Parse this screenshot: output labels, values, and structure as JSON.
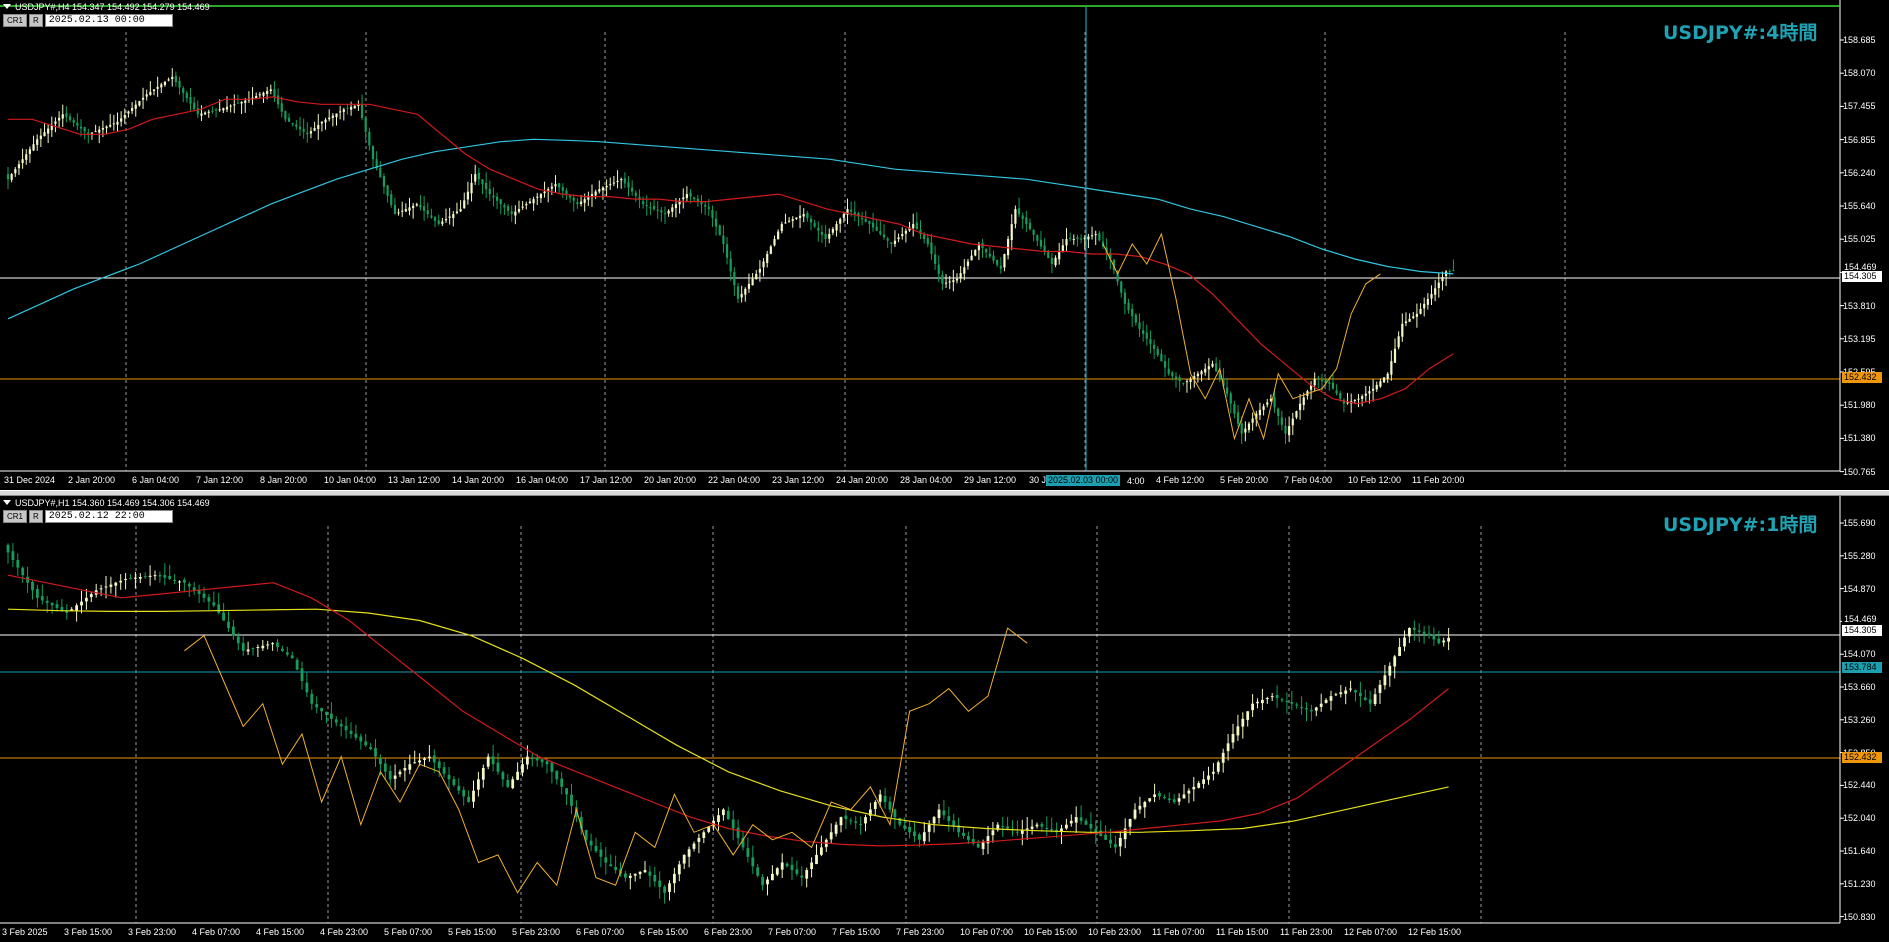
{
  "colors": {
    "background": "#000000",
    "bull": "#f4f7c6",
    "bear": "#149e5c",
    "ma_fast": "#d11a1a",
    "ma_slow_h4": "#31c6e0",
    "ma_slow_h1": "#e5e01a",
    "zigzag": "#f0b030",
    "support": "#f0960a",
    "current_price": "#ffffff",
    "crosshair": "#1aa0b0",
    "title": "#1fa3b4"
  },
  "top_panel": {
    "header": "USDJPY#,H4  154.347 154.492 154.279 154.469",
    "button_cr1": "CR1",
    "button_r": "R",
    "time_value": "2025.02.13 00:00",
    "title": "USDJPY#:4時間",
    "price_ticks": [
      "158.685",
      "158.070",
      "157.455",
      "156.855",
      "156.240",
      "155.640",
      "155.025",
      "154.410",
      "153.810",
      "153.195",
      "152.595",
      "151.980",
      "151.380",
      "150.765"
    ],
    "current_price_label": "154.469",
    "line_price_label": "154.305",
    "support_label": "152.432",
    "time_ticks": [
      "31 Dec 2024",
      "2 Jan 20:00",
      "6 Jan 04:00",
      "7 Jan 12:00",
      "8 Jan 20:00",
      "10 Jan 04:00",
      "13 Jan 12:00",
      "14 Jan 20:00",
      "16 Jan 04:00",
      "17 Jan 12:00",
      "20 Jan 20:00",
      "22 Jan 04:00",
      "23 Jan 12:00",
      "24 Jan 20:00",
      "28 Jan 04:00",
      "29 Jan 12:00",
      "30 J",
      "4 Feb 12:00",
      "5 Feb 20:00",
      "7 Feb 04:00",
      "10 Feb 12:00",
      "11 Feb 20:00"
    ],
    "crosshair_time": "2025.02.03 00:00",
    "crosshair_suffix": "4:00",
    "price_range": [
      150.45,
      159.25
    ],
    "series": {
      "start": 154.6,
      "path": [
        [
          0,
          156.3
        ],
        [
          8,
          157.1
        ],
        [
          15,
          157.6
        ],
        [
          22,
          157.2
        ],
        [
          30,
          157.45
        ],
        [
          38,
          158.0
        ],
        [
          45,
          158.35
        ],
        [
          52,
          157.6
        ],
        [
          58,
          157.7
        ],
        [
          66,
          157.9
        ],
        [
          72,
          158.1
        ],
        [
          76,
          157.5
        ],
        [
          82,
          157.2
        ],
        [
          86,
          157.45
        ],
        [
          92,
          157.7
        ],
        [
          96,
          157.8
        ],
        [
          100,
          156.7
        ],
        [
          106,
          155.6
        ],
        [
          112,
          155.8
        ],
        [
          118,
          155.4
        ],
        [
          124,
          155.7
        ],
        [
          128,
          156.4
        ],
        [
          132,
          156.0
        ],
        [
          138,
          155.6
        ],
        [
          144,
          155.9
        ],
        [
          150,
          156.2
        ],
        [
          156,
          155.8
        ],
        [
          162,
          156.1
        ],
        [
          168,
          156.3
        ],
        [
          174,
          155.8
        ],
        [
          180,
          155.6
        ],
        [
          186,
          156.0
        ],
        [
          192,
          155.7
        ],
        [
          196,
          155.0
        ],
        [
          200,
          153.9
        ],
        [
          206,
          154.5
        ],
        [
          212,
          155.4
        ],
        [
          218,
          155.6
        ],
        [
          224,
          155.1
        ],
        [
          230,
          155.7
        ],
        [
          236,
          155.4
        ],
        [
          242,
          155.0
        ],
        [
          248,
          155.4
        ],
        [
          252,
          155.0
        ],
        [
          256,
          154.2
        ],
        [
          260,
          154.3
        ],
        [
          266,
          155.0
        ],
        [
          272,
          154.5
        ],
        [
          276,
          155.7
        ],
        [
          280,
          155.3
        ],
        [
          286,
          154.6
        ],
        [
          290,
          155.1
        ],
        [
          294,
          155.1
        ],
        [
          298,
          155.2
        ],
        [
          302,
          154.7
        ],
        [
          306,
          153.8
        ],
        [
          310,
          153.3
        ],
        [
          314,
          152.9
        ],
        [
          318,
          152.4
        ],
        [
          322,
          152.2
        ],
        [
          326,
          152.4
        ],
        [
          330,
          152.6
        ],
        [
          334,
          152.0
        ],
        [
          338,
          151.2
        ],
        [
          342,
          151.6
        ],
        [
          346,
          151.9
        ],
        [
          350,
          151.2
        ],
        [
          354,
          151.8
        ],
        [
          358,
          152.3
        ],
        [
          362,
          152.2
        ],
        [
          366,
          151.8
        ],
        [
          370,
          151.9
        ],
        [
          374,
          152.1
        ],
        [
          378,
          152.4
        ],
        [
          382,
          153.4
        ],
        [
          386,
          153.6
        ],
        [
          390,
          154.0
        ],
        [
          394,
          154.45
        ],
        [
          396,
          154.47
        ]
      ],
      "ma_fast_values": [
        157.5,
        157.5,
        157.35,
        157.2,
        157.2,
        157.3,
        157.5,
        157.6,
        157.7,
        157.9,
        157.9,
        157.95,
        157.85,
        157.8,
        157.8,
        157.8,
        157.7,
        157.6,
        157.2,
        156.8,
        156.5,
        156.3,
        156.1,
        156.0,
        155.95,
        155.95,
        155.9,
        155.9,
        155.85,
        155.85,
        155.9,
        155.95,
        156.0,
        155.85,
        155.7,
        155.6,
        155.5,
        155.4,
        155.2,
        155.1,
        155.0,
        154.95,
        154.9,
        154.85,
        154.85,
        154.8,
        154.8,
        154.75,
        154.6,
        154.4,
        154.0,
        153.5,
        153.0,
        152.6,
        152.2,
        151.9,
        151.8,
        151.9,
        152.1,
        152.5,
        152.8
      ],
      "ma_slow_values": [
        153.5,
        153.8,
        154.1,
        154.35,
        154.6,
        154.9,
        155.2,
        155.5,
        155.8,
        156.05,
        156.3,
        156.5,
        156.7,
        156.85,
        156.95,
        157.05,
        157.1,
        157.08,
        157.05,
        157.0,
        156.95,
        156.9,
        156.85,
        156.8,
        156.75,
        156.7,
        156.6,
        156.5,
        156.45,
        156.4,
        156.35,
        156.3,
        156.2,
        156.1,
        156.0,
        155.9,
        155.7,
        155.55,
        155.35,
        155.15,
        154.9,
        154.7,
        154.55,
        154.45,
        154.4
      ],
      "zigzag": [
        [
          300,
          155.0
        ],
        [
          304,
          154.4
        ],
        [
          308,
          155.0
        ],
        [
          312,
          154.6
        ],
        [
          316,
          155.2
        ],
        [
          320,
          153.9
        ],
        [
          324,
          152.4
        ],
        [
          328,
          151.9
        ],
        [
          332,
          152.5
        ],
        [
          336,
          151.1
        ],
        [
          340,
          151.9
        ],
        [
          344,
          151.1
        ],
        [
          348,
          152.4
        ],
        [
          352,
          151.9
        ],
        [
          356,
          152.0
        ],
        [
          360,
          152.1
        ],
        [
          364,
          152.5
        ],
        [
          368,
          153.6
        ],
        [
          372,
          154.2
        ],
        [
          376,
          154.4
        ]
      ]
    }
  },
  "bottom_panel": {
    "header": "USDJPY#,H1  154.360 154.469 154.306 154.469",
    "button_cr1": "CR1",
    "button_r": "R",
    "time_value": "2025.02.12 22:00",
    "title": "USDJPY#:1時間",
    "price_ticks": [
      "155.690",
      "155.280",
      "154.870",
      "154.460",
      "154.070",
      "153.660",
      "153.260",
      "152.850",
      "152.440",
      "152.040",
      "151.640",
      "151.230",
      "150.830"
    ],
    "current_price_label": "154.469",
    "line_price_label": "154.305",
    "teal_label": "153.784",
    "support_label": "152.432",
    "time_ticks": [
      "3 Feb 2025",
      "3 Feb 15:00",
      "3 Feb 23:00",
      "4 Feb 07:00",
      "4 Feb 15:00",
      "4 Feb 23:00",
      "5 Feb 07:00",
      "5 Feb 15:00",
      "5 Feb 23:00",
      "6 Feb 07:00",
      "6 Feb 15:00",
      "6 Feb 23:00",
      "7 Feb 07:00",
      "7 Feb 15:00",
      "7 Feb 23:00",
      "10 Feb 07:00",
      "10 Feb 15:00",
      "10 Feb 23:00",
      "11 Feb 07:00",
      "11 Feb 15:00",
      "11 Feb 23:00",
      "12 Feb 07:00",
      "12 Feb 15:00"
    ],
    "price_range": [
      150.7,
      155.95
    ],
    "series": {
      "path": [
        [
          0,
          155.6
        ],
        [
          6,
          155.0
        ],
        [
          12,
          154.8
        ],
        [
          18,
          155.1
        ],
        [
          24,
          155.25
        ],
        [
          30,
          155.3
        ],
        [
          36,
          155.2
        ],
        [
          42,
          154.9
        ],
        [
          48,
          154.3
        ],
        [
          54,
          154.4
        ],
        [
          58,
          154.2
        ],
        [
          62,
          153.6
        ],
        [
          68,
          153.3
        ],
        [
          74,
          153.0
        ],
        [
          78,
          152.6
        ],
        [
          82,
          152.8
        ],
        [
          86,
          152.9
        ],
        [
          90,
          152.6
        ],
        [
          94,
          152.3
        ],
        [
          98,
          152.9
        ],
        [
          102,
          152.5
        ],
        [
          106,
          152.9
        ],
        [
          110,
          152.8
        ],
        [
          114,
          152.4
        ],
        [
          118,
          151.8
        ],
        [
          122,
          151.5
        ],
        [
          126,
          151.3
        ],
        [
          130,
          151.4
        ],
        [
          134,
          151.1
        ],
        [
          138,
          151.6
        ],
        [
          142,
          151.9
        ],
        [
          146,
          152.2
        ],
        [
          150,
          151.7
        ],
        [
          154,
          151.2
        ],
        [
          158,
          151.5
        ],
        [
          162,
          151.3
        ],
        [
          166,
          151.7
        ],
        [
          170,
          152.1
        ],
        [
          174,
          152.0
        ],
        [
          178,
          152.4
        ],
        [
          182,
          152.0
        ],
        [
          186,
          151.8
        ],
        [
          190,
          152.2
        ],
        [
          194,
          151.9
        ],
        [
          198,
          151.7
        ],
        [
          202,
          152.0
        ],
        [
          206,
          151.9
        ],
        [
          210,
          152.0
        ],
        [
          214,
          151.9
        ],
        [
          218,
          152.1
        ],
        [
          222,
          151.9
        ],
        [
          226,
          151.7
        ],
        [
          230,
          152.2
        ],
        [
          234,
          152.4
        ],
        [
          238,
          152.3
        ],
        [
          242,
          152.5
        ],
        [
          246,
          152.7
        ],
        [
          250,
          153.2
        ],
        [
          254,
          153.6
        ],
        [
          258,
          153.7
        ],
        [
          262,
          153.6
        ],
        [
          266,
          153.5
        ],
        [
          270,
          153.7
        ],
        [
          274,
          153.8
        ],
        [
          278,
          153.6
        ],
        [
          282,
          154.1
        ],
        [
          286,
          154.6
        ],
        [
          290,
          154.5
        ],
        [
          292,
          154.4
        ],
        [
          294,
          154.47
        ]
      ],
      "ma_fast_values": [
        155.3,
        155.2,
        155.1,
        155.0,
        155.05,
        155.1,
        155.15,
        155.2,
        155.0,
        154.7,
        154.3,
        153.9,
        153.5,
        153.2,
        152.9,
        152.7,
        152.5,
        152.3,
        152.1,
        151.95,
        151.85,
        151.78,
        151.74,
        151.72,
        151.73,
        151.75,
        151.78,
        151.82,
        151.86,
        151.9,
        151.95,
        152.0,
        152.05,
        152.15,
        152.35,
        152.7,
        153.05,
        153.4,
        153.8
      ],
      "ma_slow_values": [
        154.85,
        154.83,
        154.82,
        154.82,
        154.83,
        154.84,
        154.85,
        154.8,
        154.7,
        154.5,
        154.2,
        153.85,
        153.45,
        153.05,
        152.7,
        152.45,
        152.25,
        152.1,
        152.0,
        151.95,
        151.92,
        151.9,
        151.9,
        151.92,
        151.95,
        152.05,
        152.2,
        152.35,
        152.5
      ],
      "zigzag": [
        [
          36,
          154.3
        ],
        [
          40,
          154.5
        ],
        [
          44,
          153.9
        ],
        [
          48,
          153.3
        ],
        [
          52,
          153.6
        ],
        [
          56,
          152.8
        ],
        [
          60,
          153.2
        ],
        [
          64,
          152.3
        ],
        [
          68,
          152.9
        ],
        [
          72,
          152.0
        ],
        [
          76,
          152.7
        ],
        [
          80,
          152.3
        ],
        [
          84,
          152.8
        ],
        [
          88,
          152.7
        ],
        [
          92,
          152.2
        ],
        [
          96,
          151.5
        ],
        [
          100,
          151.6
        ],
        [
          104,
          151.1
        ],
        [
          108,
          151.5
        ],
        [
          112,
          151.2
        ],
        [
          116,
          152.2
        ],
        [
          120,
          151.3
        ],
        [
          124,
          151.2
        ],
        [
          128,
          151.9
        ],
        [
          132,
          151.7
        ],
        [
          136,
          152.4
        ],
        [
          140,
          151.9
        ],
        [
          144,
          152.0
        ],
        [
          148,
          151.6
        ],
        [
          152,
          152.0
        ],
        [
          156,
          151.8
        ],
        [
          160,
          151.9
        ],
        [
          164,
          151.7
        ],
        [
          168,
          152.3
        ],
        [
          172,
          152.2
        ],
        [
          176,
          152.5
        ],
        [
          180,
          152.0
        ],
        [
          184,
          153.5
        ],
        [
          188,
          153.6
        ],
        [
          192,
          153.8
        ],
        [
          196,
          153.5
        ],
        [
          200,
          153.7
        ],
        [
          204,
          154.6
        ],
        [
          208,
          154.4
        ]
      ]
    }
  }
}
